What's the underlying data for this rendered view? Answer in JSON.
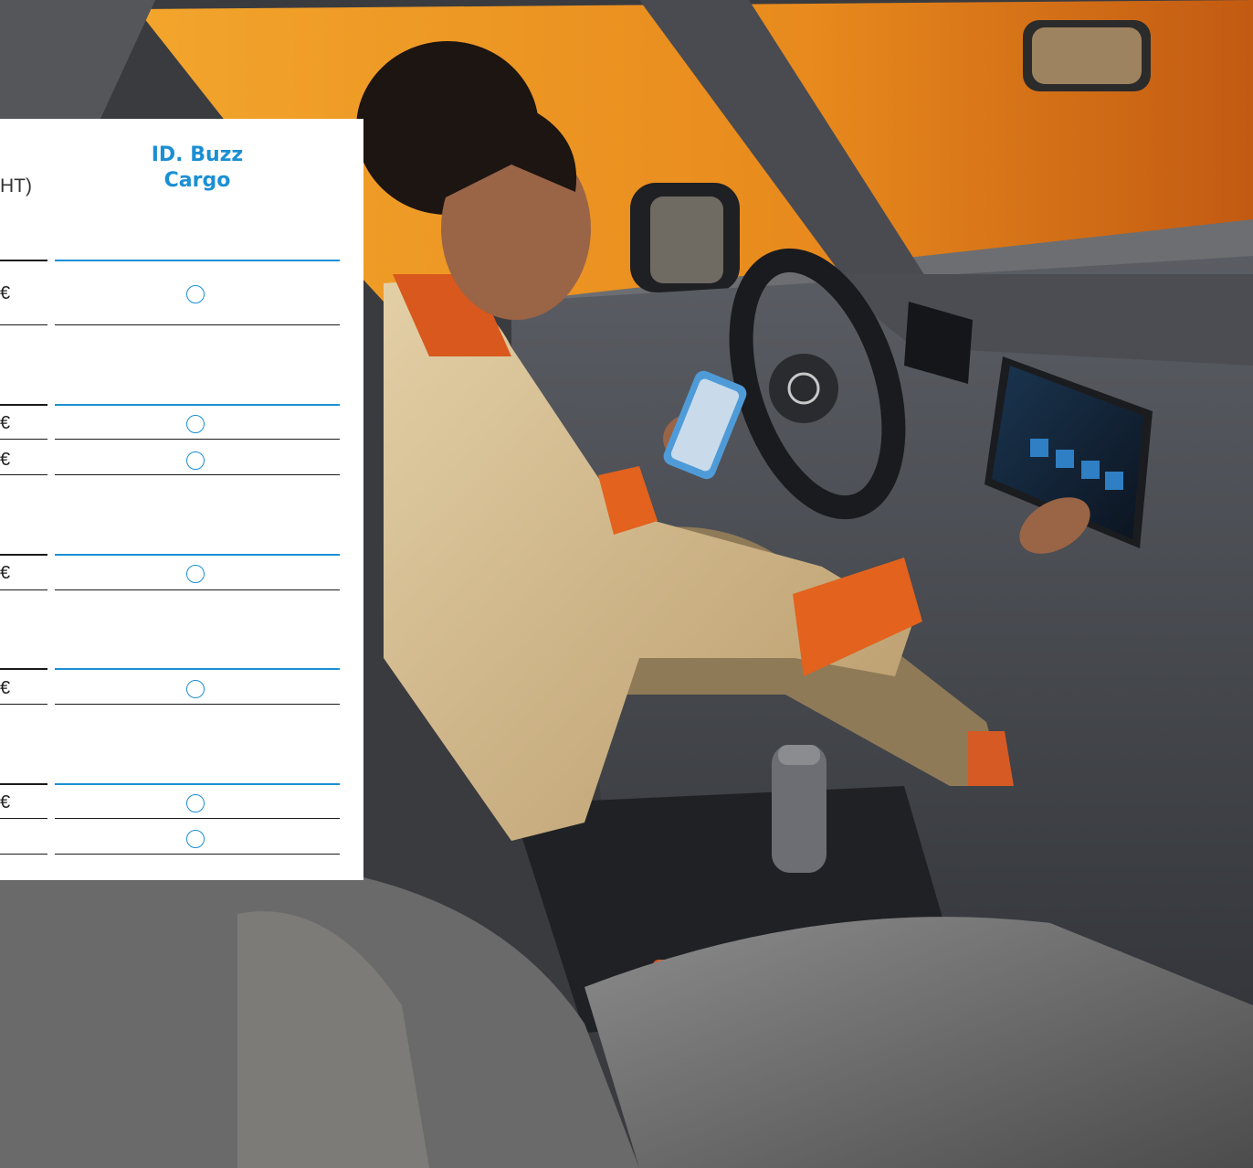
{
  "table": {
    "column_title_line1": "ID. Buzz",
    "column_title_line2": "Cargo",
    "left_header_fragment": "HT)",
    "rows": [
      {
        "price": "€",
        "option_icon": "circle-outline"
      },
      {
        "price": "€",
        "option_icon": "circle-outline"
      },
      {
        "price": "€",
        "option_icon": "circle-outline"
      },
      {
        "price": "€",
        "option_icon": "circle-outline"
      },
      {
        "price": "€",
        "option_icon": "circle-outline"
      },
      {
        "price": "€",
        "option_icon": "circle-outline"
      },
      {
        "price": "",
        "option_icon": "circle-outline"
      }
    ]
  },
  "colors": {
    "accent": "#1b8fd3",
    "rule": "#1a1a1a",
    "panel": "#ffffff"
  },
  "background_image": "car-interior-photo"
}
